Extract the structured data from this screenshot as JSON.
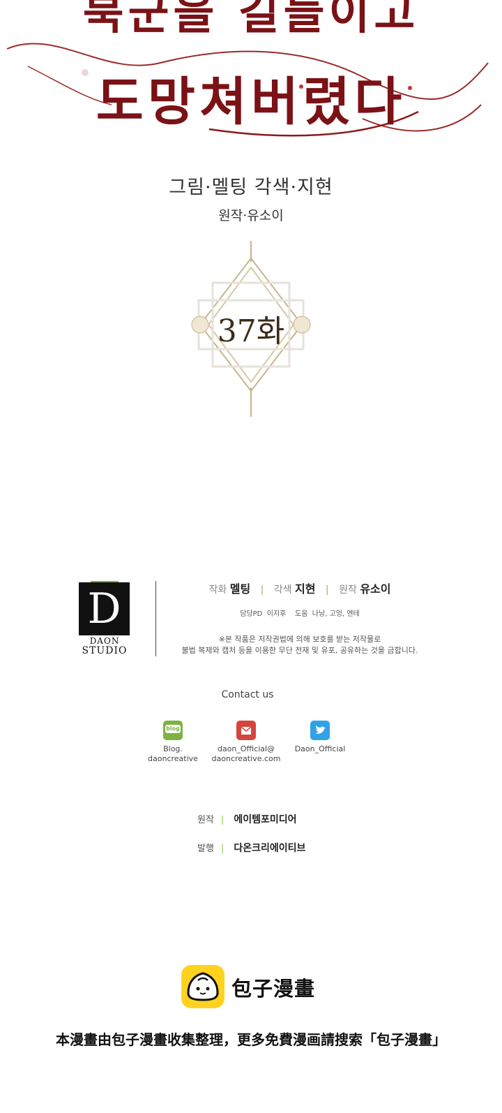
{
  "title": {
    "line1": "북군을 길들이고",
    "line2": "도망쳐버렸다"
  },
  "credits": {
    "main": "그림·멜팅 각색·지현",
    "original": "원작·유소이"
  },
  "episode": "37화",
  "studio": {
    "logo_letter": "D",
    "logo_line1": "DAON",
    "logo_line2": "STUDIO",
    "staff": [
      {
        "role": "작화",
        "name": "멜팅"
      },
      {
        "role": "각색",
        "name": "지현"
      },
      {
        "role": "원작",
        "name": "유소이"
      }
    ],
    "staff2": "담당PD  이지후    도움  나낭, 고엉, 엔테",
    "notice_line1": "※본 작품은 저작권법에 의해 보호를 받는 저작물로",
    "notice_line2": "불법 복제와 캡처 등을 이용한 무단 전재 및 유포, 공유하는 것을 금합니다."
  },
  "contact": {
    "title": "Contact us",
    "items": [
      {
        "icon": "blog-icon",
        "icon_text": "blog",
        "line1": "Blog.",
        "line2": "daoncreative",
        "color": "#7cb342"
      },
      {
        "icon": "mail-icon",
        "icon_text": "",
        "line1": "daon_Official@",
        "line2": "daoncreative.com",
        "color": "#d6453d"
      },
      {
        "icon": "twitter-icon",
        "icon_text": "",
        "line1": "Daon_Official",
        "line2": "",
        "color": "#2fa3e6"
      }
    ]
  },
  "publisher": {
    "original_label": "원작",
    "original_value": "에이템포미디어",
    "publish_label": "발행",
    "publish_value": "다온크리에이티브"
  },
  "footer": {
    "brand": "包子漫畫",
    "notice": "本漫畫由包子漫畫收集整理，更多免費漫画請搜索「包子漫畫」"
  }
}
